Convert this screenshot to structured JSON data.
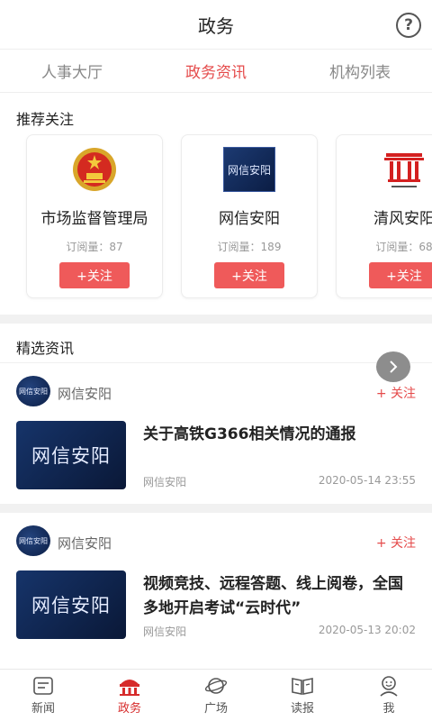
{
  "header": {
    "title": "政务",
    "help_glyph": "?"
  },
  "tabs": [
    {
      "label": "人事大厅",
      "active": false
    },
    {
      "label": "政务资讯",
      "active": true
    },
    {
      "label": "机构列表",
      "active": false
    }
  ],
  "recommend": {
    "title": "推荐关注",
    "cards": [
      {
        "name": "市场监督管理局",
        "subs": "订阅量：87",
        "follow": "+关注",
        "logo": "national-emblem-icon"
      },
      {
        "name": "网信安阳",
        "subs": "订阅量：189",
        "follow": "+关注",
        "logo_text": "网信安阳"
      },
      {
        "name": "清风安阳",
        "subs": "订阅量：68",
        "follow": "+关注",
        "logo": "qingfeng-logo-icon"
      }
    ]
  },
  "selected": {
    "title": "精选资讯",
    "items": [
      {
        "source": "网信安阳",
        "avatar_text": "网信安阳",
        "follow": "+ 关注",
        "thumb_text": "网信安阳",
        "headline": "关于高铁G366相关情况的通报",
        "meta_source": "网信安阳",
        "time": "2020-05-14 23:55"
      },
      {
        "source": "网信安阳",
        "avatar_text": "网信安阳",
        "follow": "+ 关注",
        "thumb_text": "网信安阳",
        "headline": "视频竞技、远程答题、线上阅卷，全国多地开启考试“云时代”",
        "meta_source": "网信安阳",
        "time": "2020-05-13 20:02"
      }
    ]
  },
  "bottom_nav": [
    {
      "label": "新闻",
      "icon": "news-icon",
      "active": false
    },
    {
      "label": "政务",
      "icon": "government-icon",
      "active": true
    },
    {
      "label": "广场",
      "icon": "planet-icon",
      "active": false
    },
    {
      "label": "读报",
      "icon": "newspaper-book-icon",
      "active": false
    },
    {
      "label": "我",
      "icon": "profile-icon",
      "active": false
    }
  ],
  "colors": {
    "accent": "#e54b4b",
    "follow_button": "#ef5a5a",
    "nav_active": "#d62b2b"
  }
}
